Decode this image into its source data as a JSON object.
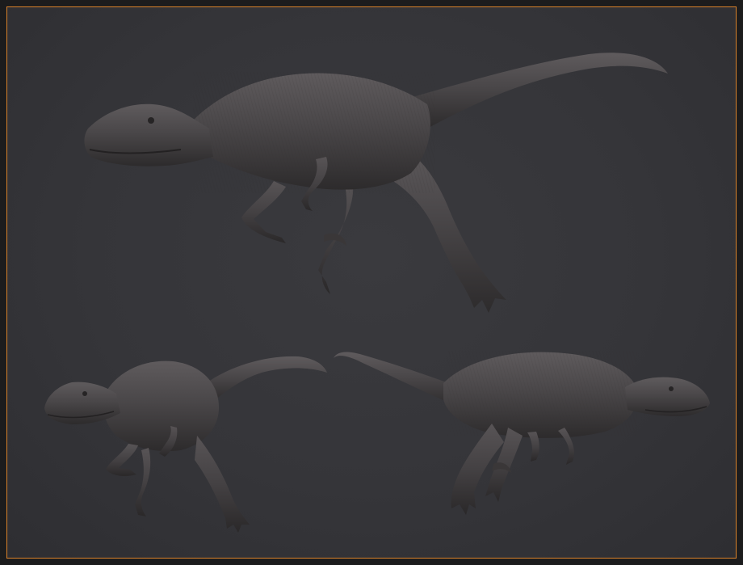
{
  "scene": {
    "subjects": [
      {
        "view": "three-quarter-front"
      },
      {
        "view": "front-left"
      },
      {
        "view": "side-right"
      }
    ]
  },
  "colors": {
    "background": "#353539",
    "frame_border": "#d9822b",
    "outer_frame": "#1c1c1d",
    "model_base": "#4a4749",
    "model_shadow": "#2a2829",
    "model_highlight": "#6b6769"
  }
}
